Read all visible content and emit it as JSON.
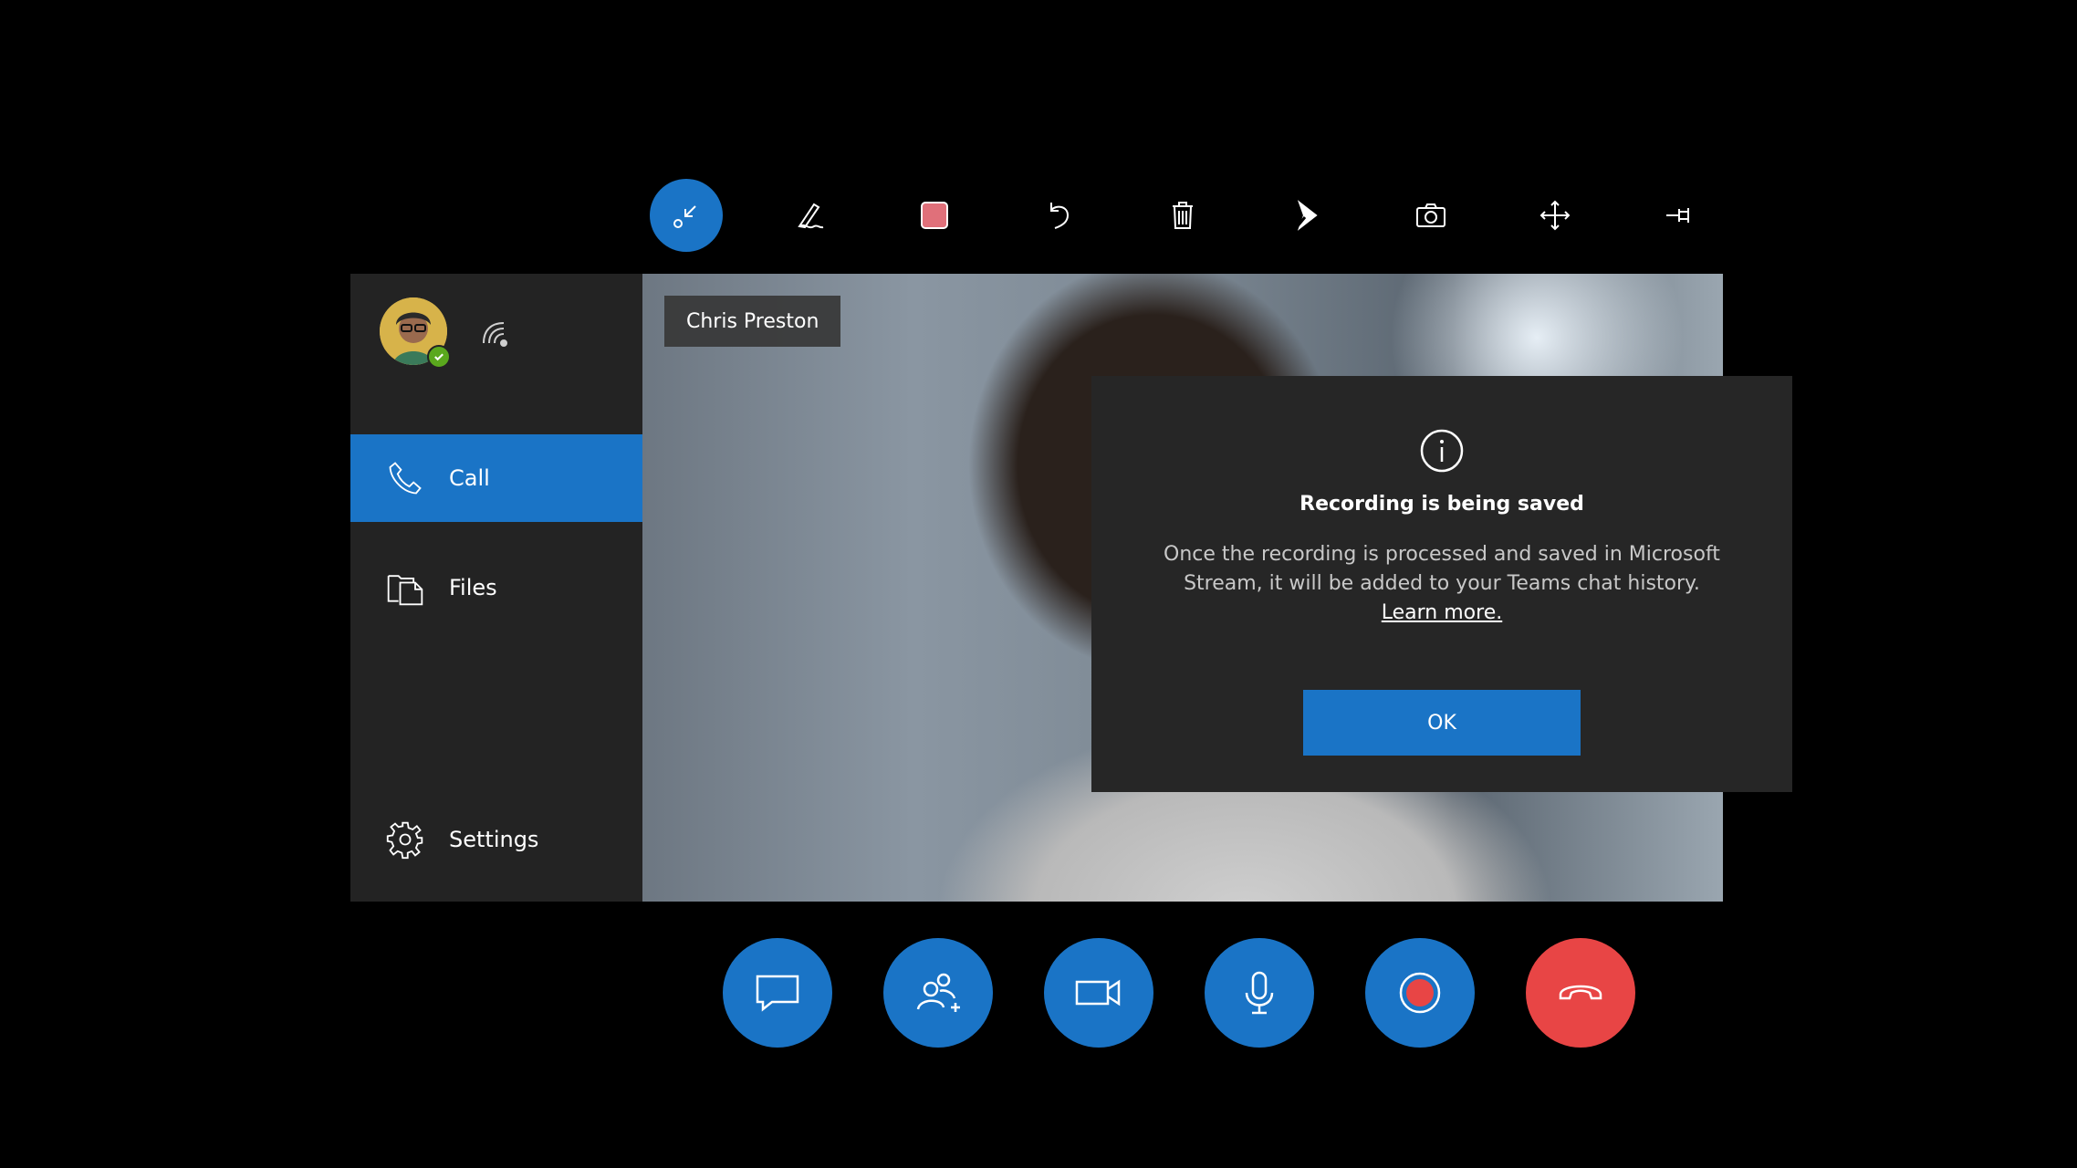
{
  "toolbar": {
    "items": [
      {
        "name": "minimize-icon",
        "active": true
      },
      {
        "name": "pen-icon"
      },
      {
        "name": "color-swatch-icon",
        "color": "#e0707a"
      },
      {
        "name": "undo-icon"
      },
      {
        "name": "delete-icon"
      },
      {
        "name": "arrow-pointer-icon"
      },
      {
        "name": "camera-icon"
      },
      {
        "name": "move-icon"
      },
      {
        "name": "pin-icon"
      }
    ]
  },
  "sidebar": {
    "status": "online",
    "nav": [
      {
        "label": "Call",
        "icon": "phone-icon",
        "selected": true
      },
      {
        "label": "Files",
        "icon": "files-icon",
        "selected": false
      },
      {
        "label": "Settings",
        "icon": "gear-icon",
        "selected": false
      }
    ]
  },
  "video": {
    "participant_name": "Chris Preston"
  },
  "dialog": {
    "icon": "info-icon",
    "title": "Recording is being saved",
    "body": "Once the recording is processed and saved in Microsoft Stream, it will be added to your Teams chat history.",
    "link": "Learn more.",
    "ok_label": "OK"
  },
  "controls": [
    {
      "name": "chat-icon"
    },
    {
      "name": "add-people-icon"
    },
    {
      "name": "video-camera-icon"
    },
    {
      "name": "microphone-icon"
    },
    {
      "name": "record-icon"
    },
    {
      "name": "hang-up-icon",
      "color": "#e84545"
    }
  ],
  "colors": {
    "accent": "#1a74c6",
    "danger": "#e84545",
    "panel": "#232323",
    "record": "#e84545",
    "presence": "#5aa81d"
  }
}
